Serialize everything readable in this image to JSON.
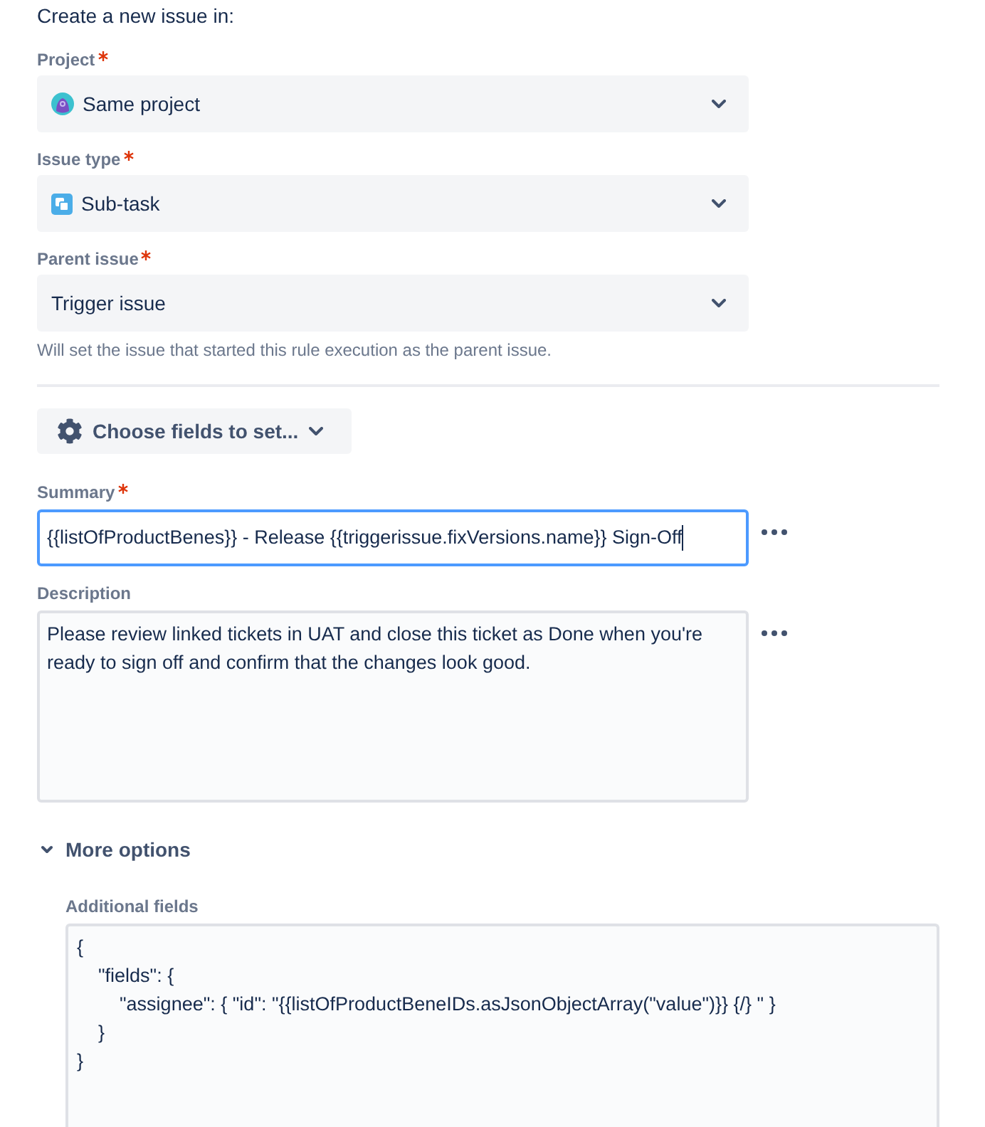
{
  "heading": "Create a new issue in:",
  "selects": [
    {
      "kind": "project",
      "label": "Project",
      "required": true,
      "value": "Same project"
    },
    {
      "kind": "issue_type",
      "label": "Issue type",
      "required": true,
      "value": "Sub-task"
    },
    {
      "kind": "parent",
      "label": "Parent issue",
      "required": true,
      "value": "Trigger issue",
      "helper": "Will set the issue that started this rule execution as the parent issue."
    }
  ],
  "choose_fields_button": {
    "label": "Choose fields to set..."
  },
  "fields": [
    {
      "kind": "input",
      "label": "Summary",
      "required": true,
      "value": "{{listOfProductBenes}} - Release {{triggerissue.fixVersions.name}} Sign-Off",
      "focused": true
    },
    {
      "kind": "textarea",
      "label": "Description",
      "value": "Please review linked tickets in UAT and close this ticket as Done when you're ready to sign off and confirm that the changes look good.",
      "focused": false
    }
  ],
  "more_options": {
    "label": "More options",
    "expanded": true,
    "additional_fields": {
      "label": "Additional fields",
      "value": "{\n    \"fields\": {\n        \"assignee\": { \"id\": \"{{listOfProductBeneIDs.asJsonObjectArray(\"value\")}} {/} \" }\n    }\n}"
    }
  }
}
